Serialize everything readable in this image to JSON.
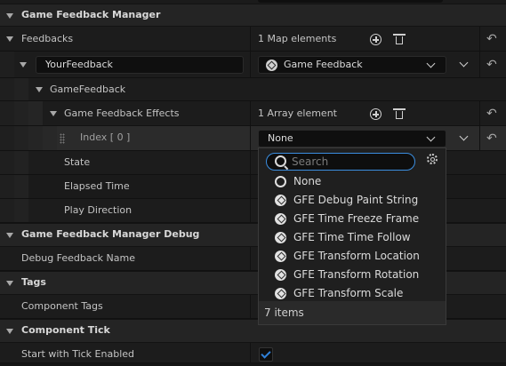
{
  "sections": {
    "game_feedback_manager": "Game Feedback Manager",
    "game_feedback_manager_debug": "Game Feedback Manager Debug",
    "tags": "Tags",
    "component_tick": "Component Tick"
  },
  "feedbacks": {
    "label": "Feedbacks",
    "count_text": "1 Map elements",
    "key_value": "YourFeedback",
    "value_label": "Game Feedback"
  },
  "game_feedback": {
    "label": "GameFeedback",
    "effects_label": "Game Feedback Effects",
    "effects_count": "1 Array element",
    "index_label": "Index [ 0 ]",
    "index_value": "None"
  },
  "properties": {
    "state": "State",
    "elapsed_time": "Elapsed Time",
    "play_direction": "Play Direction",
    "debug_feedback_name": "Debug Feedback Name",
    "component_tags": "Component Tags",
    "start_with_tick_enabled": "Start with Tick Enabled"
  },
  "dropdown": {
    "search_placeholder": "Search",
    "options": [
      {
        "label": "None",
        "icon": "none-ring-icon"
      },
      {
        "label": "GFE Debug Paint String",
        "icon": "class-icon"
      },
      {
        "label": "GFE Time Freeze Frame",
        "icon": "class-icon"
      },
      {
        "label": "GFE Time Time Follow",
        "icon": "class-icon"
      },
      {
        "label": "GFE Transform Location",
        "icon": "class-icon"
      },
      {
        "label": "GFE Transform Rotation",
        "icon": "class-icon"
      },
      {
        "label": "GFE Transform Scale",
        "icon": "class-icon"
      }
    ],
    "footer": "7 items"
  },
  "colors": {
    "accent": "#3b8ee0",
    "checkbox": "#2f80d8",
    "section_bg": "#242424",
    "row_bg": "#1c1c1c"
  }
}
